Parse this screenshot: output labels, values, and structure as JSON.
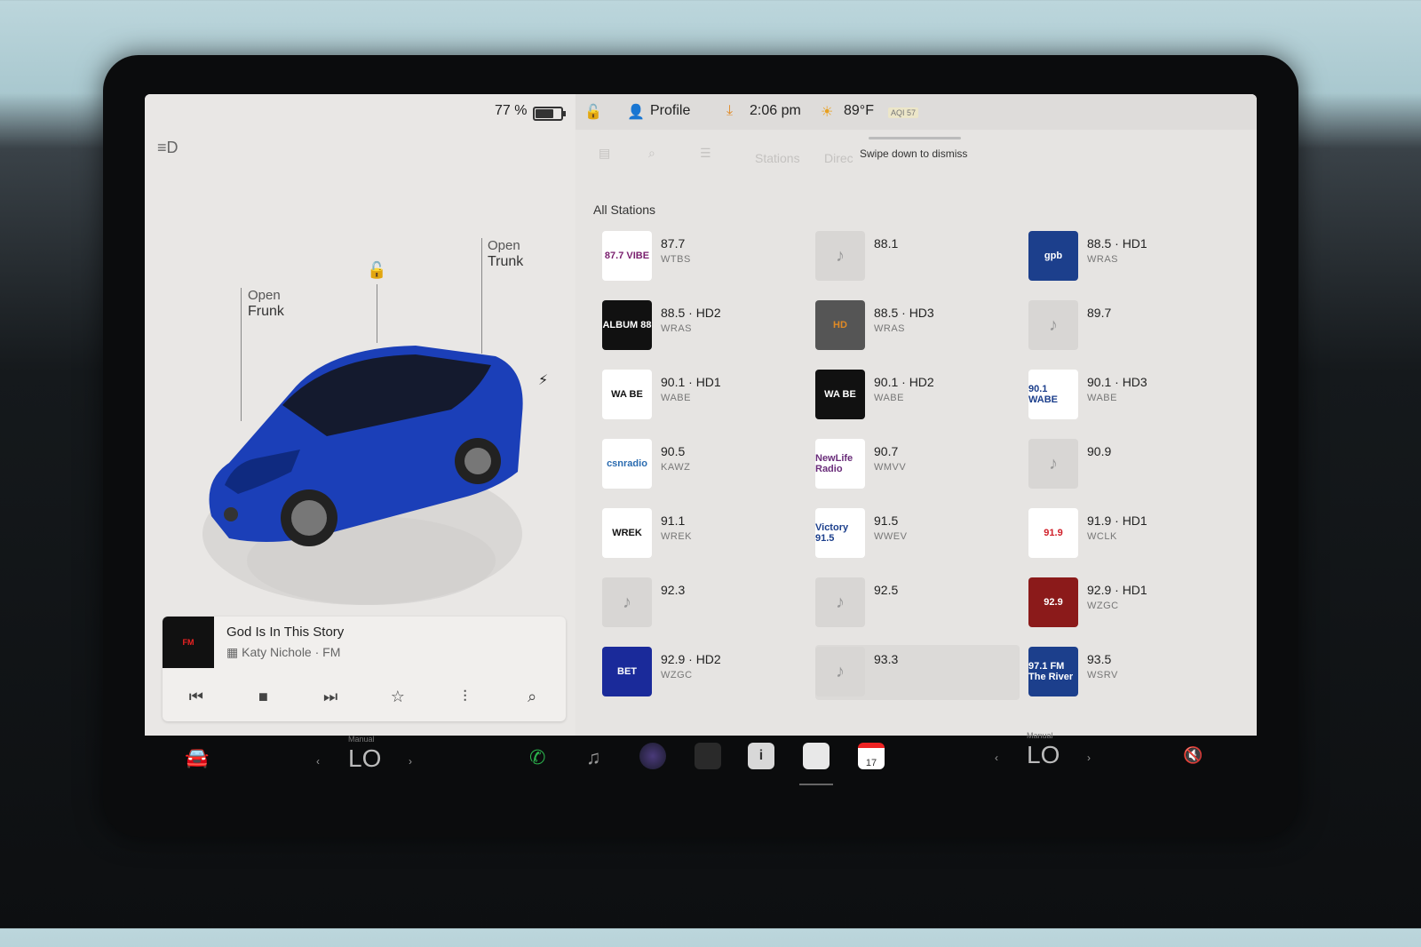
{
  "status": {
    "battery": "77 %",
    "battery_level": 0.77,
    "profile": "Profile",
    "time": "2:06 pm",
    "temp": "89°F",
    "aqi": "AQI 57"
  },
  "car_panel": {
    "frunk_top": "Open",
    "frunk_bottom": "Frunk",
    "trunk_top": "Open",
    "trunk_bottom": "Trunk"
  },
  "media": {
    "song": "God Is In This Story",
    "artist": "Katy Nichole · FM"
  },
  "tabs": {
    "stations": "Stations",
    "direct": "Direc",
    "swipe_hint": "Swipe down to dismiss"
  },
  "section_title": "All Stations",
  "stations": [
    {
      "freq": "87.7",
      "call": "WTBS",
      "logo": "87.7 VIBE",
      "logo_color": "#7a1f6e",
      "logo_bg": "#ffffff"
    },
    {
      "freq": "88.1",
      "call": "",
      "logo": "",
      "placeholder": true
    },
    {
      "freq": "88.5 · HD1",
      "call": "WRAS",
      "logo": "gpb",
      "logo_color": "#ffffff",
      "logo_bg": "#1c3f8c"
    },
    {
      "freq": "88.5 · HD2",
      "call": "WRAS",
      "logo": "ALBUM 88",
      "logo_color": "#ffffff",
      "logo_bg": "#111111"
    },
    {
      "freq": "88.5 · HD3",
      "call": "WRAS",
      "logo": "HD",
      "logo_color": "#e08a25",
      "logo_bg": "#555555"
    },
    {
      "freq": "89.7",
      "call": "",
      "logo": "",
      "placeholder": true
    },
    {
      "freq": "90.1 · HD1",
      "call": "WABE",
      "logo": "WA BE",
      "logo_color": "#111111",
      "logo_bg": "#ffffff"
    },
    {
      "freq": "90.1 · HD2",
      "call": "WABE",
      "logo": "WA BE",
      "logo_color": "#ffffff",
      "logo_bg": "#111111"
    },
    {
      "freq": "90.1 · HD3",
      "call": "WABE",
      "logo": "90.1 WABE",
      "logo_color": "#1c3f8c",
      "logo_bg": "#ffffff"
    },
    {
      "freq": "90.5",
      "call": "KAWZ",
      "logo": "csnradio",
      "logo_color": "#2a6bb0",
      "logo_bg": "#ffffff"
    },
    {
      "freq": "90.7",
      "call": "WMVV",
      "logo": "NewLife Radio",
      "logo_color": "#6a2d7a",
      "logo_bg": "#ffffff"
    },
    {
      "freq": "90.9",
      "call": "",
      "logo": "",
      "placeholder": true
    },
    {
      "freq": "91.1",
      "call": "WREK",
      "logo": "WREK",
      "logo_color": "#111111",
      "logo_bg": "#ffffff"
    },
    {
      "freq": "91.5",
      "call": "WWEV",
      "logo": "Victory 91.5",
      "logo_color": "#1c3f8c",
      "logo_bg": "#ffffff"
    },
    {
      "freq": "91.9 · HD1",
      "call": "WCLK",
      "logo": "91.9",
      "logo_color": "#d0202a",
      "logo_bg": "#ffffff"
    },
    {
      "freq": "92.3",
      "call": "",
      "logo": "",
      "placeholder": true
    },
    {
      "freq": "92.5",
      "call": "",
      "logo": "",
      "placeholder": true
    },
    {
      "freq": "92.9 · HD1",
      "call": "WZGC",
      "logo": "92.9",
      "logo_color": "#ffffff",
      "logo_bg": "#8b1a1a"
    },
    {
      "freq": "92.9 · HD2",
      "call": "WZGC",
      "logo": "BET",
      "logo_color": "#ffffff",
      "logo_bg": "#1a2a9a"
    },
    {
      "freq": "93.3",
      "call": "",
      "logo": "",
      "placeholder": true,
      "selected": true
    },
    {
      "freq": "93.5",
      "call": "WSRV",
      "logo": "97.1 FM The River",
      "logo_color": "#ffffff",
      "logo_bg": "#1c3f8c"
    }
  ],
  "dock": {
    "left_temp": "LO",
    "left_temp_mode": "Manual",
    "right_temp": "LO",
    "right_temp_mode": "Manual",
    "calendar_day": "17"
  }
}
